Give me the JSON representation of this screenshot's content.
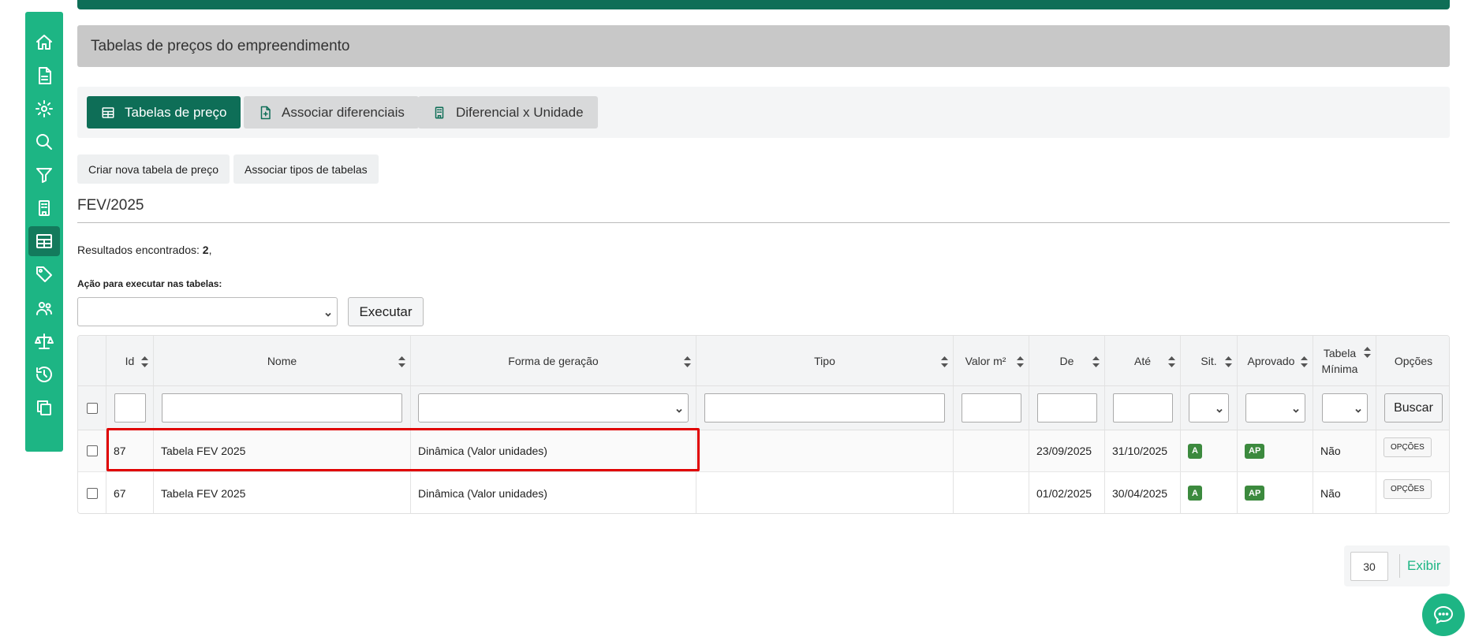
{
  "sidebar": {
    "items": [
      {
        "icon": "home-icon"
      },
      {
        "icon": "document-icon"
      },
      {
        "icon": "gear-icon"
      },
      {
        "icon": "search-icon"
      },
      {
        "icon": "filter-icon"
      },
      {
        "icon": "building-icon"
      },
      {
        "icon": "table-icon",
        "active": true
      },
      {
        "icon": "tag-icon"
      },
      {
        "icon": "users-icon"
      },
      {
        "icon": "scale-icon"
      },
      {
        "icon": "history-icon"
      },
      {
        "icon": "copy-icon"
      }
    ]
  },
  "header": {
    "title": "Tabelas de preços do empreendimento"
  },
  "tabs": [
    {
      "label": "Tabelas de preço",
      "icon": "table-icon",
      "active": true
    },
    {
      "label": "Associar diferenciais",
      "icon": "file-plus-icon",
      "active": false
    },
    {
      "label": "Diferencial x Unidade",
      "icon": "building-icon",
      "active": false
    }
  ],
  "actions": {
    "create_label": "Criar nova tabela de preço",
    "associate_label": "Associar tipos de tabelas"
  },
  "section": {
    "title": "FEV/2025"
  },
  "results": {
    "label": "Resultados encontrados:",
    "count": "2",
    "suffix": ","
  },
  "bulk_action": {
    "label": "Ação para executar nas tabelas:",
    "selected": "",
    "button": "Executar"
  },
  "table": {
    "columns": [
      {
        "label": "Id"
      },
      {
        "label": "Nome"
      },
      {
        "label": "Forma de geração"
      },
      {
        "label": "Tipo"
      },
      {
        "label": "Valor m²"
      },
      {
        "label": "De"
      },
      {
        "label": "Até"
      },
      {
        "label": "Sit."
      },
      {
        "label": "Aprovado"
      },
      {
        "label": "Tabela Mínima"
      },
      {
        "label": "Opções"
      }
    ],
    "search_button": "Buscar",
    "rows": [
      {
        "id": "87",
        "nome": "Tabela FEV 2025",
        "forma": "Dinâmica (Valor unidades)",
        "tipo": "",
        "valor": "",
        "de": "23/09/2025",
        "ate": "31/10/2025",
        "sit": "A",
        "aprovado": "AP",
        "minima": "Não",
        "opcoes": "OPÇÕES"
      },
      {
        "id": "67",
        "nome": "Tabela FEV 2025",
        "forma": "Dinâmica (Valor unidades)",
        "tipo": "",
        "valor": "",
        "de": "01/02/2025",
        "ate": "30/04/2025",
        "sit": "A",
        "aprovado": "AP",
        "minima": "Não",
        "opcoes": "OPÇÕES"
      }
    ]
  },
  "pagination": {
    "per_page": "30",
    "show_label": "Exibir"
  },
  "colors": {
    "brand_green": "#1db584",
    "dark_green": "#0e6e57",
    "badge_green": "#3c8a3e",
    "highlight_red": "#e00000"
  }
}
